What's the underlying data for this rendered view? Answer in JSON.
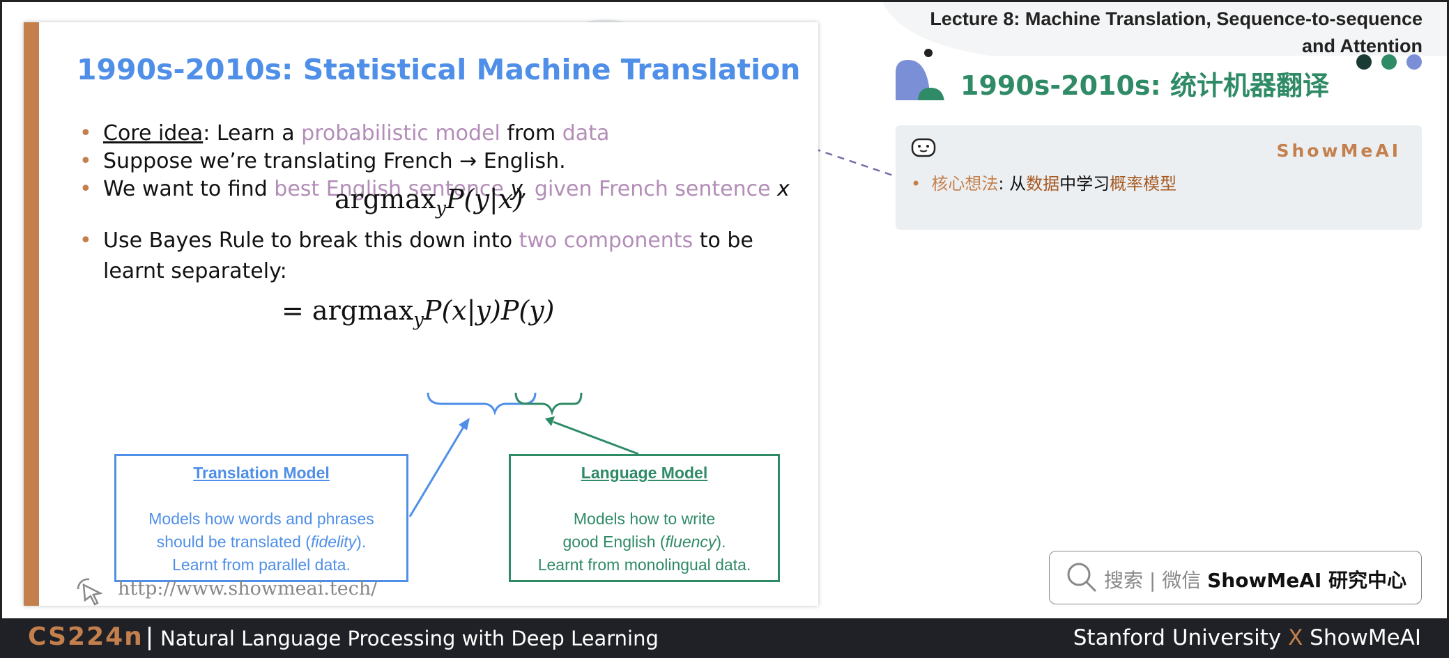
{
  "slide": {
    "title": "1990s-2010s: Statistical Machine Translation",
    "bullet1": {
      "term": "Core idea",
      "rest_a": ": Learn a ",
      "hl1": "probabilistic model",
      "mid": " from ",
      "hl2": "data"
    },
    "bullet2": "Suppose we’re translating French → English.",
    "bullet3": {
      "a": "We want to find ",
      "hl1": "best English sentence",
      "b": " y,",
      "hl2": " given French sentence",
      "c": " x"
    },
    "formula1": {
      "op": "argmax",
      "sub": "y",
      "expr": "P(y|x)"
    },
    "bullet4": {
      "a": "Use Bayes Rule to break this down into ",
      "hl": "two components",
      "b": " to be learnt separately:"
    },
    "formula2": {
      "prefix": "= argmax",
      "sub": "y",
      "expr1": "P(x|y)",
      "expr2": "P(y)"
    },
    "translation_model": {
      "title": "Translation Model",
      "line1": "Models how words and phrases",
      "line2a": "should be translated (",
      "line2b": "fidelity",
      "line2c": ").",
      "line3": "Learnt from parallel data."
    },
    "language_model": {
      "title": "Language Model",
      "line1": "Models how to write",
      "line2a": "good English (",
      "line2b": "fluency",
      "line2c": ").",
      "line3": "Learnt from monolingual data."
    },
    "url": "http://www.showmeai.tech/"
  },
  "panel": {
    "lecture_line1": "Lecture 8:  Machine Translation, Sequence-to-sequence",
    "lecture_line2": "and Attention",
    "cn_title": "1990s-2010s: 统计机器翻译",
    "brand": "ShowMeAI",
    "note": {
      "term": "核心想法",
      "colon": ": 从",
      "w1": "数据",
      "mid": "中学习",
      "w2": "概率模型"
    },
    "search": {
      "prefix": "搜索 | 微信 ",
      "name": "ShowMeAI 研究中心"
    }
  },
  "footer": {
    "course_code": "CS224n",
    "course_name": "Natural Language Processing with Deep Learning",
    "left": "Stanford University",
    "x": "X",
    "right": "ShowMeAI"
  },
  "colors": {
    "accent": "#c4804c",
    "blue": "#4f8fe8",
    "green": "#2f8a66",
    "highlight": "#b38db8"
  }
}
